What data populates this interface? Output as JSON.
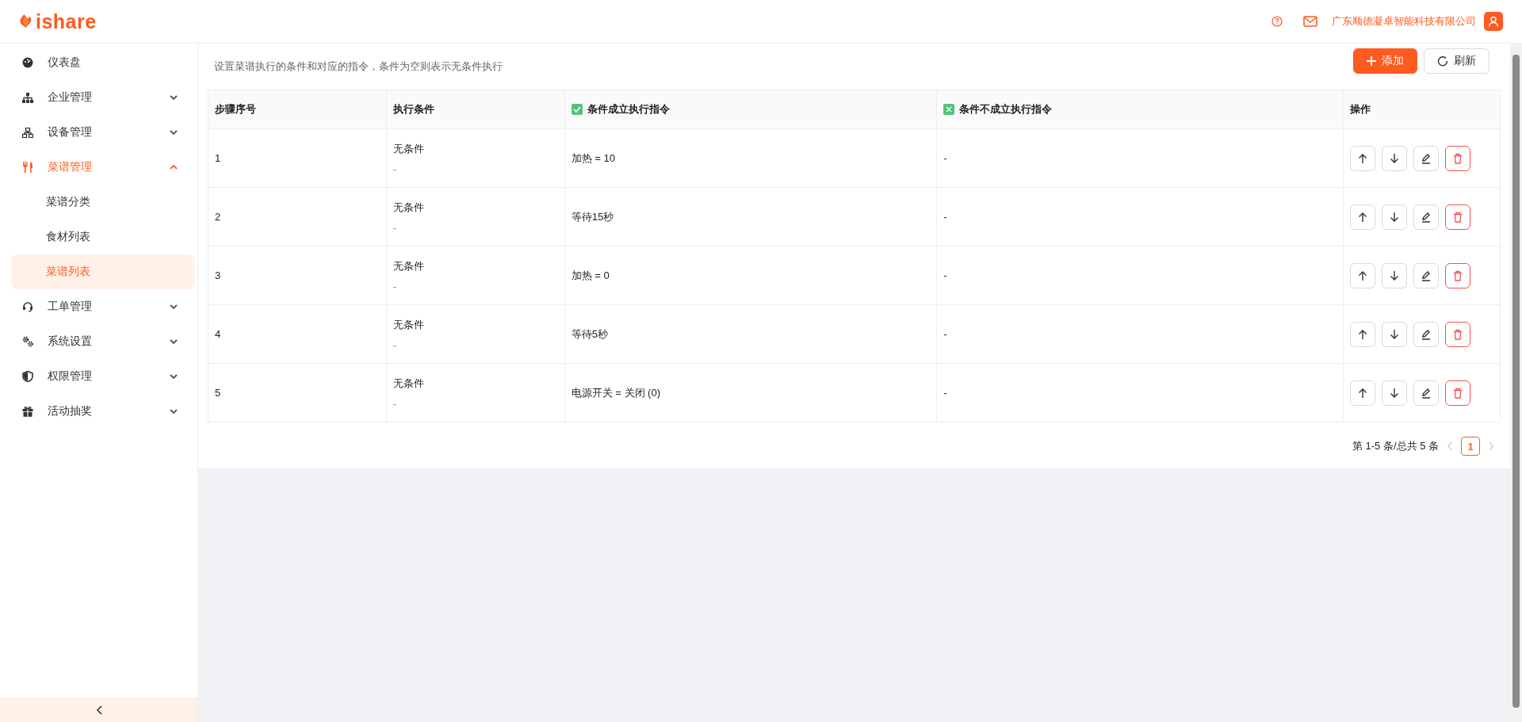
{
  "header": {
    "logo": "ishare",
    "company": "广东顺德凝卓智能科技有限公司"
  },
  "sidebar": {
    "items": [
      {
        "label": "仪表盘",
        "kind": "link",
        "selected": false
      },
      {
        "label": "企业管理",
        "kind": "group",
        "expanded": false
      },
      {
        "label": "设备管理",
        "kind": "group",
        "expanded": false
      },
      {
        "label": "菜谱管理",
        "kind": "group",
        "expanded": true,
        "children": [
          {
            "label": "菜谱分类",
            "selected": false
          },
          {
            "label": "食材列表",
            "selected": false
          },
          {
            "label": "菜谱列表",
            "selected": true
          }
        ]
      },
      {
        "label": "工单管理",
        "kind": "group",
        "expanded": false
      },
      {
        "label": "系统设置",
        "kind": "group",
        "expanded": false
      },
      {
        "label": "权限管理",
        "kind": "group",
        "expanded": false
      },
      {
        "label": "活动抽奖",
        "kind": "group",
        "expanded": false
      }
    ]
  },
  "toolbar": {
    "description": "设置菜谱执行的条件和对应的指令，条件为空则表示无条件执行",
    "buttons": [
      {
        "label": "添加",
        "kind": "primary"
      },
      {
        "label": "刷新",
        "kind": "default"
      }
    ]
  },
  "table": {
    "columns": [
      {
        "label": "步骤序号",
        "kind": "plain"
      },
      {
        "label": "执行条件",
        "kind": "plain"
      },
      {
        "label": "条件成立执行指令",
        "kind": "check"
      },
      {
        "label": "条件不成立执行指令",
        "kind": "cross"
      },
      {
        "label": "操作",
        "kind": "plain"
      }
    ],
    "rows": [
      {
        "step": "1",
        "condition": "无条件",
        "condition_detail": "-",
        "then": "加热 = 10",
        "else": "-"
      },
      {
        "step": "2",
        "condition": "无条件",
        "condition_detail": "-",
        "then": "等待15秒",
        "else": "-"
      },
      {
        "step": "3",
        "condition": "无条件",
        "condition_detail": "-",
        "then": "加热 = 0",
        "else": "-"
      },
      {
        "step": "4",
        "condition": "无条件",
        "condition_detail": "-",
        "then": "等待5秒",
        "else": "-"
      },
      {
        "step": "5",
        "condition": "无条件",
        "condition_detail": "-",
        "then": "电源开关 = 关闭 (0)",
        "else": "-"
      }
    ]
  },
  "pagination": {
    "summary": "第 1-5 条/总共 5 条",
    "pages": [
      {
        "label": "1",
        "selected": true
      }
    ]
  }
}
